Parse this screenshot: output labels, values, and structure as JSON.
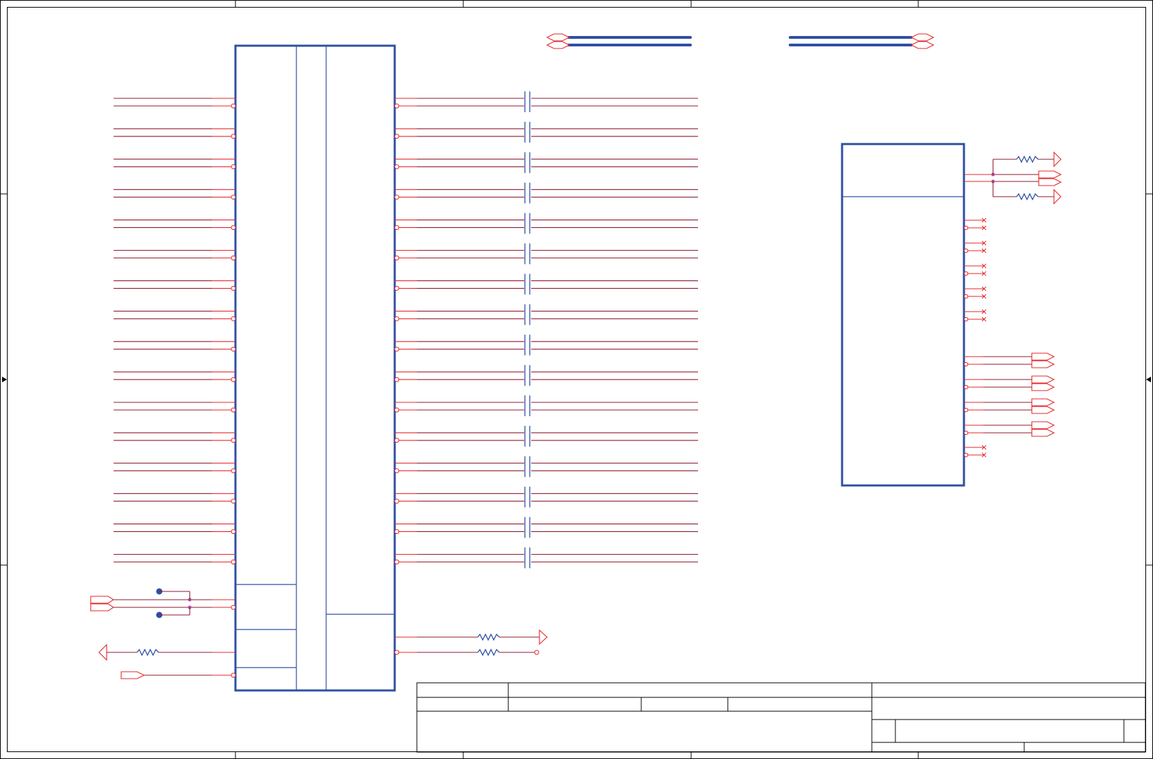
{
  "diagram": {
    "kind": "electrical-schematic",
    "colors": {
      "component_outline": "#2f4fa3",
      "pin": "#e4272b",
      "net_wire": "#8c1a2e",
      "junction": "#b04aa8",
      "frame": "#000000"
    },
    "connector": {
      "left_diff_pairs": 16,
      "right_diff_pairs": 16,
      "series_capacitors": 16
    },
    "controller": {
      "terminated_diff_pairs": 1,
      "unconnected_pin_pairs": 6,
      "output_port_pairs": 4
    },
    "text": []
  }
}
